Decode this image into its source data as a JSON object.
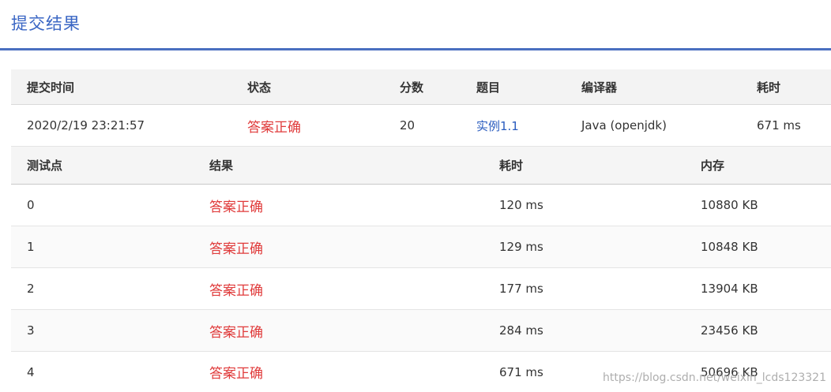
{
  "header": {
    "title": "提交结果"
  },
  "summary": {
    "columns": {
      "time": "提交时间",
      "status": "状态",
      "score": "分数",
      "problem": "题目",
      "compiler": "编译器",
      "duration": "耗时"
    },
    "row": {
      "time": "2020/2/19 23:21:57",
      "status": "答案正确",
      "score": "20",
      "problem": "实例1.1",
      "compiler": "Java (openjdk)",
      "duration": "671 ms"
    }
  },
  "cases": {
    "columns": {
      "id": "测试点",
      "result": "结果",
      "time": "耗时",
      "memory": "内存"
    },
    "rows": [
      {
        "id": "0",
        "result": "答案正确",
        "time": "120 ms",
        "memory": "10880 KB"
      },
      {
        "id": "1",
        "result": "答案正确",
        "time": "129 ms",
        "memory": "10848 KB"
      },
      {
        "id": "2",
        "result": "答案正确",
        "time": "177 ms",
        "memory": "13904 KB"
      },
      {
        "id": "3",
        "result": "答案正确",
        "time": "284 ms",
        "memory": "23456 KB"
      },
      {
        "id": "4",
        "result": "答案正确",
        "time": "671 ms",
        "memory": "50696 KB"
      }
    ]
  },
  "watermark": "https://blog.csdn.net/weixin_lcds123321",
  "colors": {
    "accent": "#3a66c4",
    "accepted": "#e03b3b",
    "link": "#2a5cbf"
  }
}
